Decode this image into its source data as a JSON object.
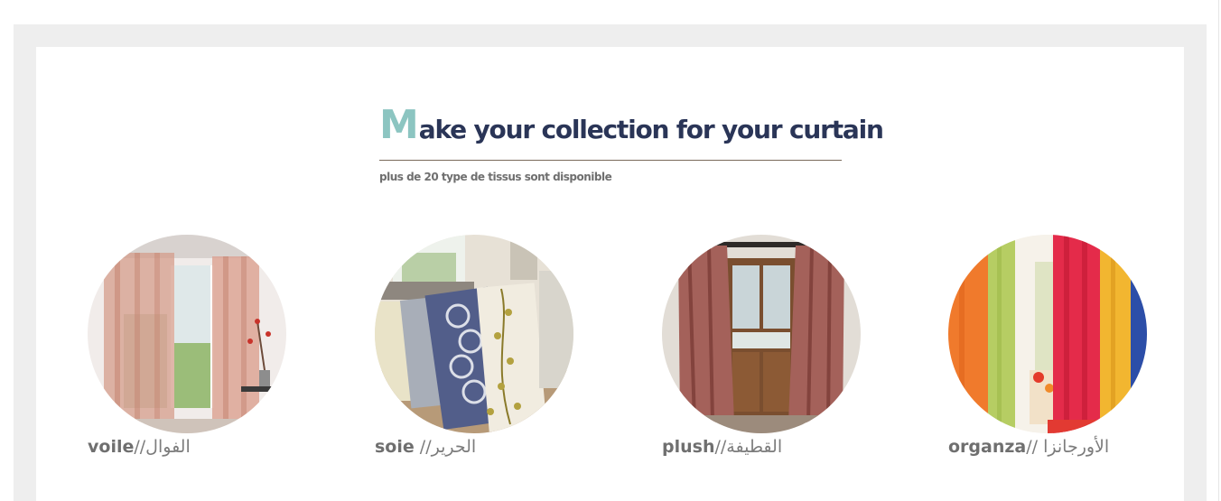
{
  "heading": {
    "first_letter": "M",
    "rest": "ake your collection for your curtain",
    "subtitle": "plus de 20 type de tissus sont disponible"
  },
  "fabrics": [
    {
      "latin": "voile",
      "separator": "//",
      "arabic": "الفوال",
      "image": "sheer-curtain-photo"
    },
    {
      "latin": "soie",
      "separator": " //",
      "arabic": "الحرير",
      "image": "silk-fabric-photo"
    },
    {
      "latin": "plush",
      "separator": "//",
      "arabic": "القطيفة",
      "image": "plush-curtain-photo"
    },
    {
      "latin": "organza",
      "separator": "// ",
      "arabic": "الأورجانزا",
      "image": "organza-curtain-photo"
    }
  ],
  "colors": {
    "heading": "#2a3557",
    "accent": "#8cc5c1",
    "frame": "#eeeeee",
    "label": "#7c7c7c"
  }
}
